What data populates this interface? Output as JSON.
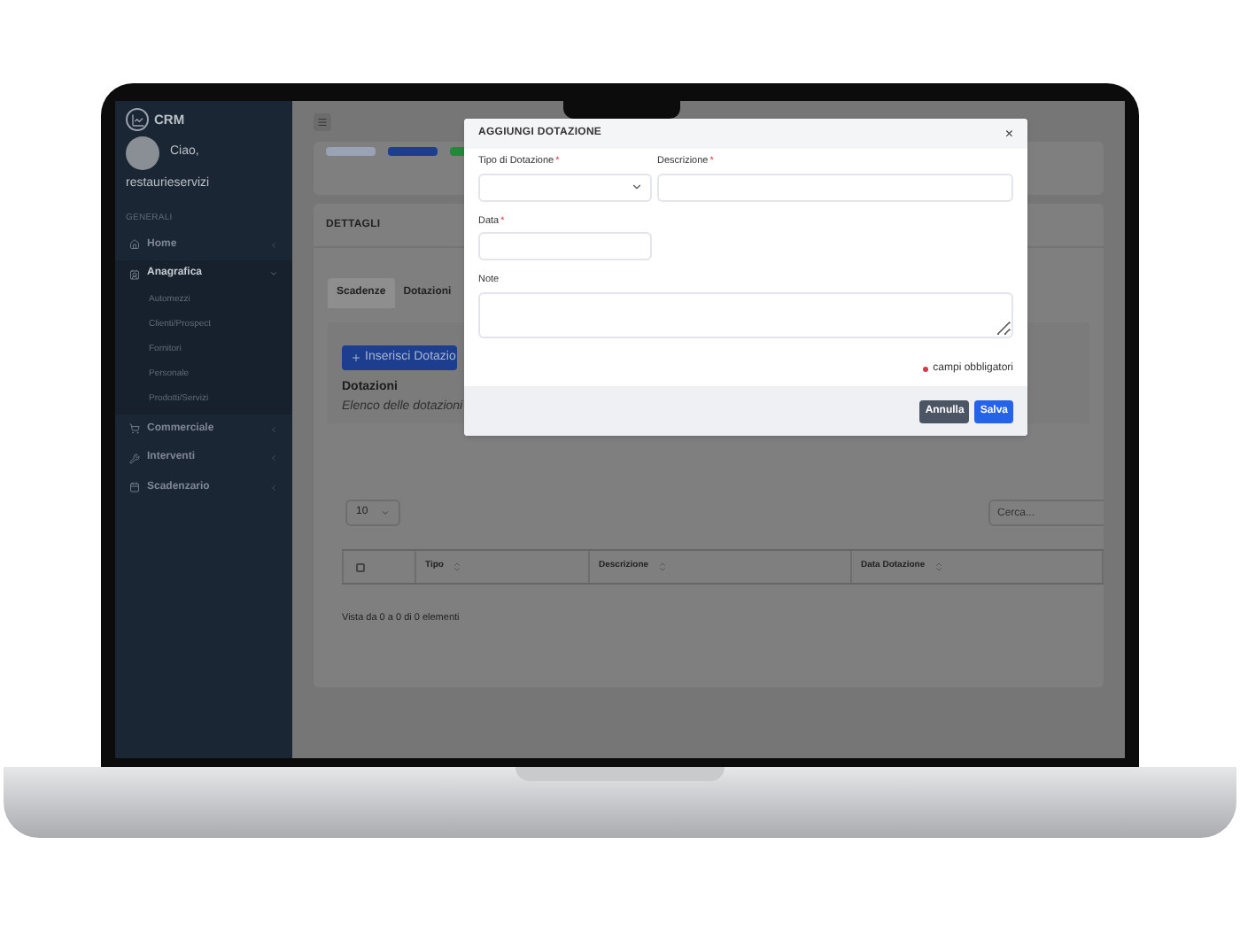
{
  "sidebar": {
    "brand": "CRM",
    "greeting": "Ciao,",
    "user": "restaurieservizi",
    "section": "GENERALI",
    "items": [
      {
        "label": "Home",
        "expanded": false
      },
      {
        "label": "Anagrafica",
        "expanded": true,
        "children": [
          {
            "label": "Automezzi"
          },
          {
            "label": "Clienti/Prospect"
          },
          {
            "label": "Fornitori"
          },
          {
            "label": "Personale"
          },
          {
            "label": "Prodotti/Servizi"
          }
        ]
      },
      {
        "label": "Commerciale",
        "expanded": false
      },
      {
        "label": "Interventi",
        "expanded": false
      },
      {
        "label": "Scadenzario",
        "expanded": false
      }
    ]
  },
  "page": {
    "header_buttons": [
      {
        "color": "#9aa3b5"
      },
      {
        "color": "#1d3e8f"
      },
      {
        "color": "#1f8a3a"
      }
    ],
    "section_title": "DETTAGLI",
    "tabs": [
      {
        "label": "Scadenze",
        "selected": true
      },
      {
        "label": "Dotazioni",
        "selected": false
      }
    ],
    "add_button": "Inserisci Dotazio",
    "list_title": "Dotazioni",
    "list_subtitle": "Elenco delle dotazioni",
    "page_length": "10",
    "search": {
      "placeholder": "Cerca..."
    },
    "table": {
      "columns": [
        "Tipo",
        "Descrizione",
        "Data Dotazione"
      ],
      "checked": false
    },
    "info": "Vista da 0 a 0 di 0 elementi"
  },
  "modal": {
    "title": "AGGIUNGI DOTAZIONE",
    "close": "×",
    "fields": [
      {
        "label": "Tipo di Dotazione",
        "mark": "*",
        "kind": "select"
      },
      {
        "label": "Descrizione",
        "mark": "*",
        "kind": "text"
      },
      {
        "label": "Data",
        "mark": "*",
        "kind": "text"
      },
      {
        "label": "Note",
        "kind": "textarea"
      }
    ],
    "legend": "campi obbligatori",
    "buttons": [
      {
        "label": "Annulla",
        "kind": "secondary"
      },
      {
        "label": "Salva",
        "kind": "primary"
      }
    ]
  }
}
